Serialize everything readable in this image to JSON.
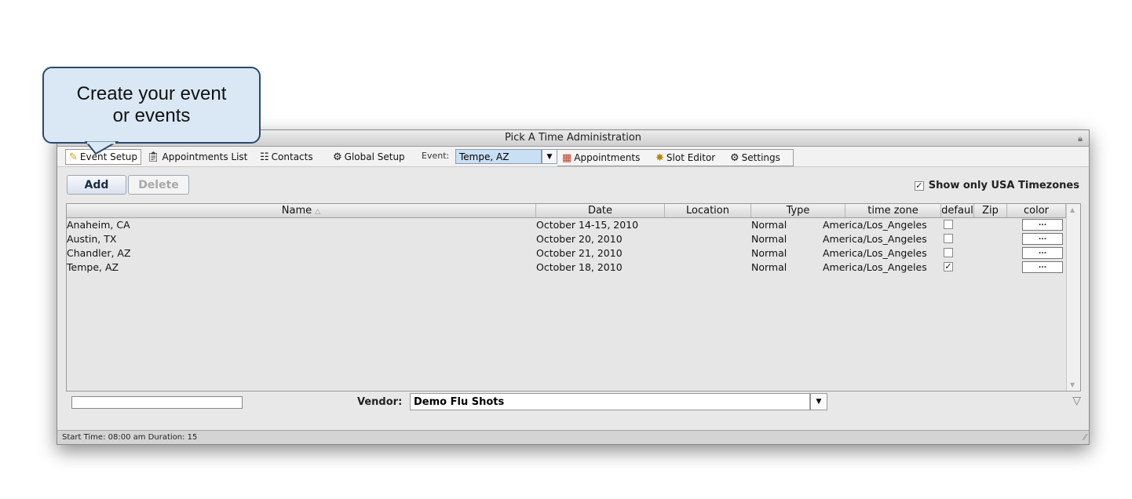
{
  "callout": {
    "line1": "Create your event",
    "line2": "or events"
  },
  "window": {
    "title": "Pick A Time Administration"
  },
  "tabs": [
    {
      "label": "Event Setup",
      "icon": "folder-pencil-icon"
    },
    {
      "label": "Appointments List",
      "icon": "clipboard-icon"
    },
    {
      "label": "Contacts",
      "icon": "contacts-icon"
    },
    {
      "label": "Global Setup",
      "icon": "gear-icon"
    }
  ],
  "event": {
    "label": "Event:",
    "value": "Tempe, AZ"
  },
  "subtabs": [
    {
      "label": "Appointments",
      "icon": "calendar-icon"
    },
    {
      "label": "Slot Editor",
      "icon": "slot-editor-icon"
    },
    {
      "label": "Settings",
      "icon": "settings-icon"
    }
  ],
  "toolbar": {
    "add_label": "Add",
    "delete_label": "Delete",
    "usa_label": "Show only USA Timezones",
    "usa_checked": true
  },
  "table": {
    "columns": [
      "Name",
      "Date",
      "Location",
      "Type",
      "time zone",
      "defaul",
      "Zip",
      "color"
    ],
    "rows": [
      {
        "name": "Anaheim, CA",
        "date": "October 14-15, 2010",
        "location": "",
        "type": "Normal",
        "timezone": "America/Los_Angeles",
        "default": false,
        "zip": "",
        "color": "..."
      },
      {
        "name": "Austin, TX",
        "date": "October 20, 2010",
        "location": "",
        "type": "Normal",
        "timezone": "America/Los_Angeles",
        "default": false,
        "zip": "",
        "color": "..."
      },
      {
        "name": "Chandler, AZ",
        "date": "October 21, 2010",
        "location": "",
        "type": "Normal",
        "timezone": "America/Los_Angeles",
        "default": false,
        "zip": "",
        "color": "..."
      },
      {
        "name": "Tempe, AZ",
        "date": "October 18, 2010",
        "location": "",
        "type": "Normal",
        "timezone": "America/Los_Angeles",
        "default": true,
        "zip": "",
        "color": "..."
      }
    ]
  },
  "vendor": {
    "label": "Vendor:",
    "value": "Demo Flu Shots"
  },
  "status": {
    "text": "Start Time: 08:00 am Duration: 15"
  }
}
